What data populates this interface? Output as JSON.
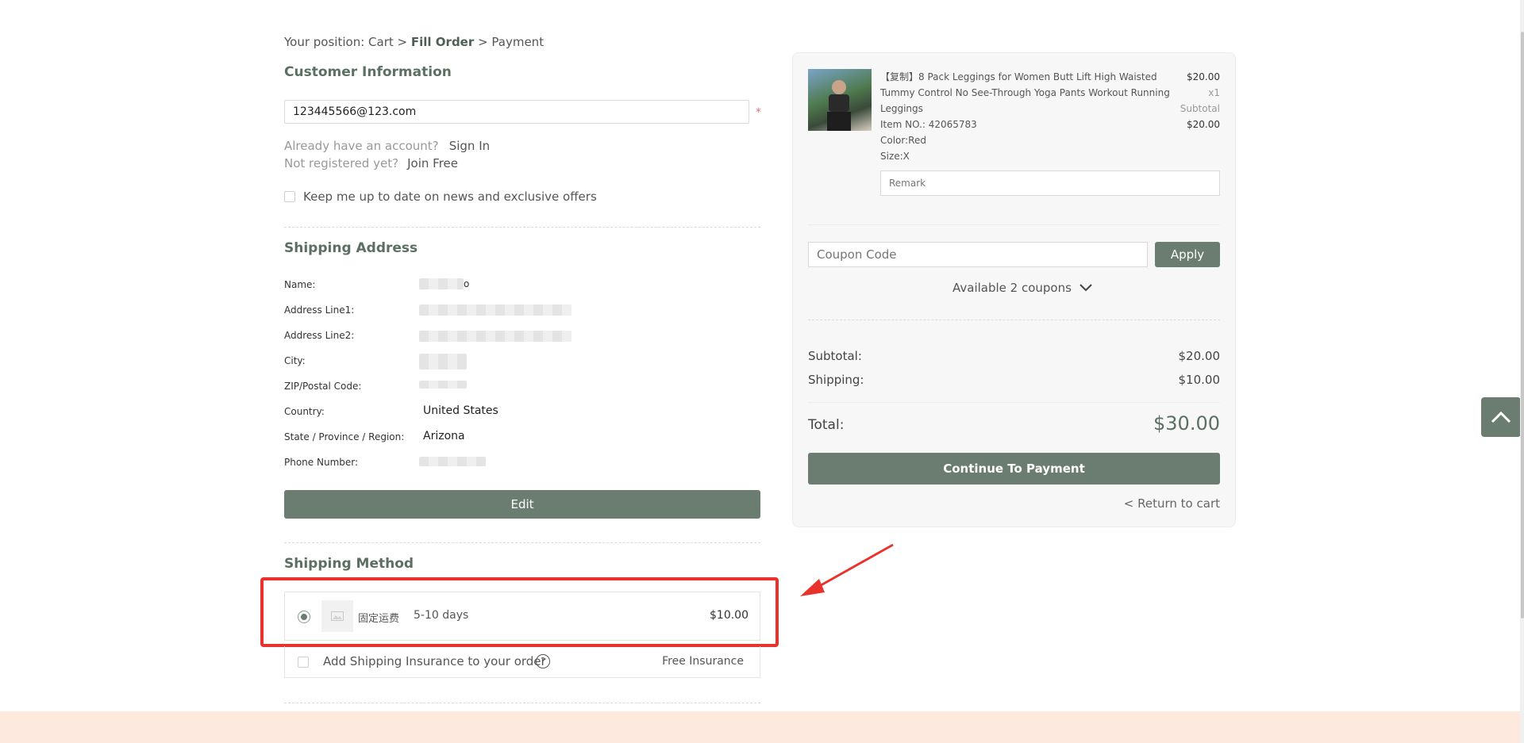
{
  "breadcrumb": {
    "prefix": "Your position:",
    "cart": "Cart",
    "sep1": ">",
    "fill_order": "Fill Order",
    "sep2": ">",
    "payment": "Payment"
  },
  "customer": {
    "title": "Customer Information",
    "email_value": "123445566@123.com",
    "required_mark": "*",
    "account_q": "Already have an account?",
    "sign_in": "Sign In",
    "register_q": "Not registered yet?",
    "join_free": "Join Free",
    "newsletter": "Keep me up to date on news and exclusive offers"
  },
  "shipping_address": {
    "title": "Shipping Address",
    "labels": {
      "name": "Name:",
      "line1": "Address Line1:",
      "line2": "Address Line2:",
      "city": "City:",
      "zip": "ZIP/Postal Code:",
      "country": "Country:",
      "state": "State / Province / Region:",
      "phone": "Phone Number:"
    },
    "country_value": "United States",
    "state_value": "Arizona",
    "name_suffix": "o",
    "edit_label": "Edit"
  },
  "shipping_method": {
    "title": "Shipping Method",
    "option_name": "固定运费",
    "option_days": "5-10 days",
    "option_price": "$10.00",
    "insurance_label": "Add Shipping Insurance to your order",
    "help_icon_glyph": "?",
    "insurance_value": "Free Insurance"
  },
  "order": {
    "product_title": "【复制】8 Pack Leggings for Women Butt Lift High Waisted Tummy Control No See-Through Yoga Pants Workout Running Leggings",
    "item_no": "Item NO.: 42065783",
    "color": "Color:Red",
    "size": "Size:X",
    "price": "$20.00",
    "qty": "x1",
    "subtotal_label": "Subtotal",
    "subtotal_value": "$20.00",
    "remark_placeholder": "Remark",
    "coupon_placeholder": "Coupon Code",
    "apply_label": "Apply",
    "coupons_available": "Available 2 coupons",
    "summary_subtotal_label": "Subtotal:",
    "summary_subtotal_value": "$20.00",
    "summary_shipping_label": "Shipping:",
    "summary_shipping_value": "$10.00",
    "total_label": "Total:",
    "total_value": "$30.00",
    "continue_label": "Continue To Payment",
    "return_label": "< Return to cart"
  },
  "colors": {
    "accent": "#6b7d71",
    "annotation": "#e8322b",
    "footer": "#fde9dd"
  }
}
